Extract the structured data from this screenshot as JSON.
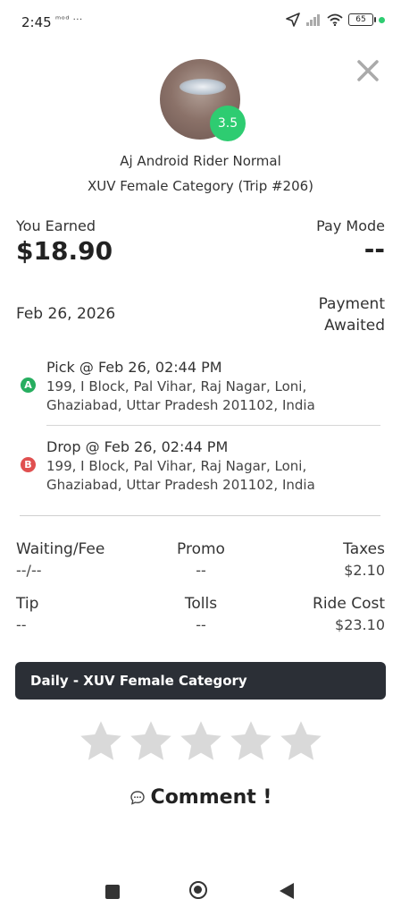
{
  "status_bar": {
    "time": "2:45",
    "extra": "ᵐᵒᵈ ···",
    "battery": "65"
  },
  "rider": {
    "rating": "3.5",
    "name": "Aj Android Rider Normal",
    "subtitle": "XUV Female Category (Trip #206)"
  },
  "earnings": {
    "label": "You Earned",
    "value": "$18.90",
    "pay_mode_label": "Pay Mode",
    "pay_mode_value": "--"
  },
  "trip": {
    "date": "Feb 26, 2026",
    "payment_status": "Payment Awaited",
    "pickup": {
      "marker": "A",
      "title": "Pick @ Feb 26, 02:44 PM",
      "address": "199, I Block, Pal Vihar, Raj Nagar, Loni, Ghaziabad, Uttar Pradesh 201102, India"
    },
    "drop": {
      "marker": "B",
      "title": "Drop @ Feb 26, 02:44 PM",
      "address": "199, I Block, Pal Vihar, Raj Nagar, Loni, Ghaziabad, Uttar Pradesh 201102, India"
    }
  },
  "fare": {
    "waiting_label": "Waiting/Fee",
    "waiting_value": "--/--",
    "promo_label": "Promo",
    "promo_value": "--",
    "taxes_label": "Taxes",
    "taxes_value": "$2.10",
    "tip_label": "Tip",
    "tip_value": "--",
    "tolls_label": "Tolls",
    "tolls_value": "--",
    "ride_cost_label": "Ride Cost",
    "ride_cost_value": "$23.10"
  },
  "category_bar": "Daily - XUV Female Category",
  "rating_input": {
    "stars_total": 5,
    "stars_selected": 0
  },
  "comment_label": "Comment !",
  "icons": {
    "close": "close-icon",
    "comment": "chat-bubble-icon",
    "star": "star-icon",
    "nav_recents": "square-icon",
    "nav_home": "circle-icon",
    "nav_back": "triangle-back-icon"
  },
  "colors": {
    "rating_badge": "#2ecc71",
    "pickup_marker": "#27ae60",
    "drop_marker": "#e05050",
    "category_bar": "#2b2f36",
    "star_empty": "#d9d9d9"
  }
}
